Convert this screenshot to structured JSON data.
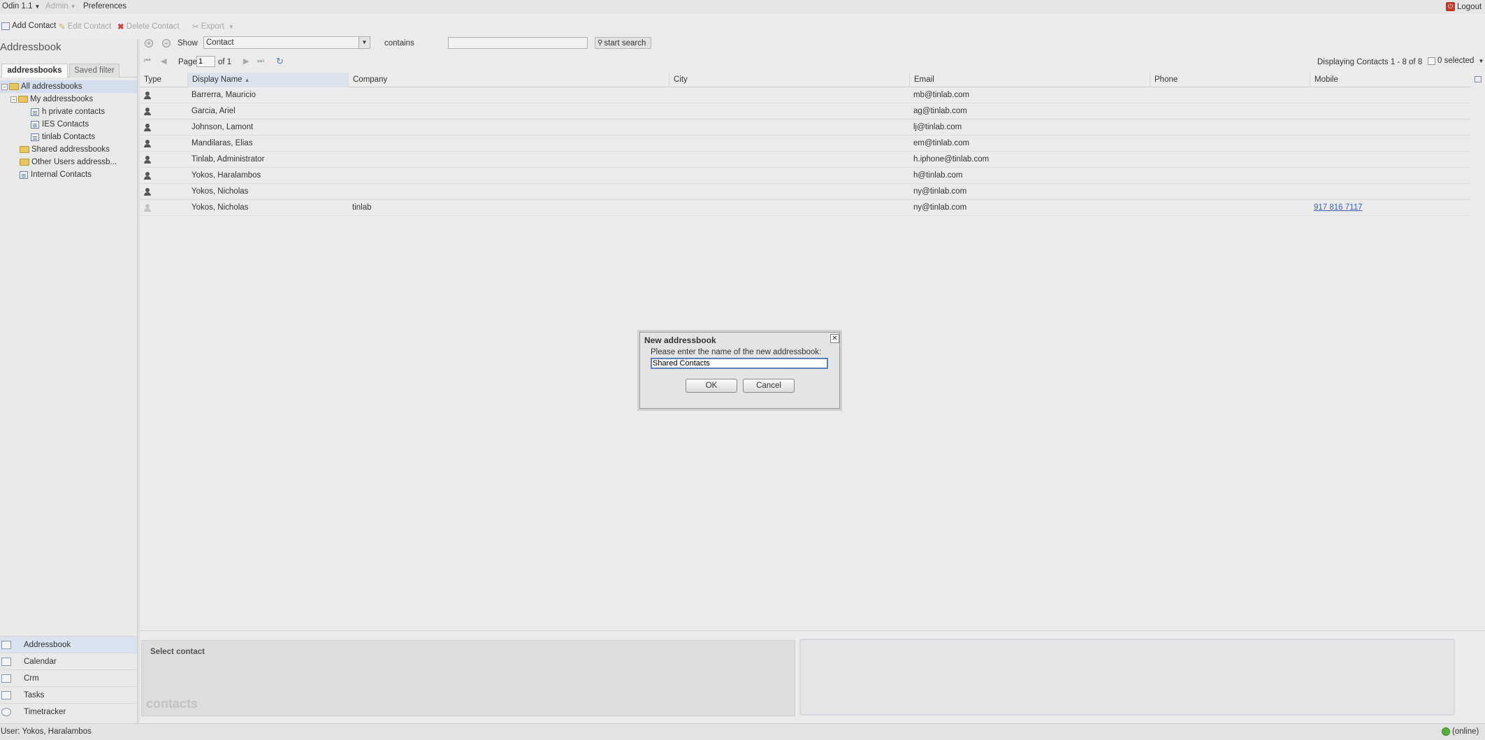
{
  "menu": {
    "app": "Odin 1.1",
    "admin": "Admin",
    "preferences": "Preferences",
    "logout": "Logout"
  },
  "toolbar": {
    "add": "Add Contact",
    "edit": "Edit Contact",
    "delete": "Delete Contact",
    "export": "Export"
  },
  "sidebar": {
    "title": "Addressbook",
    "tabs": [
      "addressbooks",
      "Saved filter"
    ],
    "tree": [
      "All addressbooks",
      "My addressbooks",
      "h private contacts",
      "IES Contacts",
      "tinlab Contacts",
      "Shared addressbooks",
      "Other Users addressb...",
      "Internal Contacts"
    ]
  },
  "apps": [
    "Addressbook",
    "Calendar",
    "Crm",
    "Tasks",
    "Timetracker"
  ],
  "search": {
    "show_label": "Show",
    "field": "Contact",
    "operator": "contains",
    "value": "",
    "button": "start search"
  },
  "paging": {
    "page_label": "Page",
    "page": "1",
    "of": "of 1",
    "displaying": "Displaying Contacts 1 - 8 of 8",
    "selected": "0 selected"
  },
  "grid": {
    "columns": [
      "Type",
      "Display Name",
      "Company",
      "City",
      "Email",
      "Phone",
      "Mobile"
    ],
    "rows": [
      {
        "name": "Barrerra, Mauricio",
        "company": "",
        "city": "",
        "email": "mb@tinlab.com",
        "phone": "",
        "mobile": ""
      },
      {
        "name": "Garcia, Ariel",
        "company": "",
        "city": "",
        "email": "ag@tinlab.com",
        "phone": "",
        "mobile": ""
      },
      {
        "name": "Johnson, Lamont",
        "company": "",
        "city": "",
        "email": "lj@tinlab.com",
        "phone": "",
        "mobile": ""
      },
      {
        "name": "Mandilaras, Elias",
        "company": "",
        "city": "",
        "email": "em@tinlab.com",
        "phone": "",
        "mobile": ""
      },
      {
        "name": "Tinlab, Administrator",
        "company": "",
        "city": "",
        "email": "h.iphone@tinlab.com",
        "phone": "",
        "mobile": ""
      },
      {
        "name": "Yokos, Haralambos",
        "company": "",
        "city": "",
        "email": "h@tinlab.com",
        "phone": "",
        "mobile": ""
      },
      {
        "name": "Yokos, Nicholas",
        "company": "",
        "city": "",
        "email": "ny@tinlab.com",
        "phone": "",
        "mobile": ""
      },
      {
        "name": "Yokos, Nicholas",
        "company": "tinlab",
        "city": "",
        "email": "ny@tinlab.com",
        "phone": "",
        "mobile": "917 816 7117"
      }
    ]
  },
  "detail": {
    "heading": "Select contact",
    "watermark": "contacts"
  },
  "dialog": {
    "title": "New addressbook",
    "prompt": "Please enter the name of the new addressbook:",
    "value": "Shared Contacts",
    "ok": "OK",
    "cancel": "Cancel"
  },
  "status": {
    "user": "User: Yokos, Haralambos",
    "online": "(online)"
  }
}
